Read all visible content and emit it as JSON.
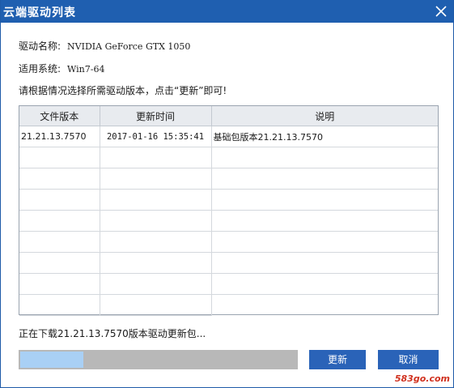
{
  "window": {
    "title": "云端驱动列表",
    "close_icon": "close-icon"
  },
  "info": {
    "driver_name_label": "驱动名称:",
    "driver_name_value": "NVIDIA GeForce GTX 1050",
    "system_label": "适用系统:",
    "system_value": "Win7-64",
    "instruction": "请根据情况选择所需驱动版本，点击“更新”即可!"
  },
  "table": {
    "headers": [
      "文件版本",
      "更新时间",
      "说明"
    ],
    "rows": [
      [
        "21.21.13.7570",
        "2017-01-16 15:35:41",
        "基础包版本21.21.13.7570"
      ]
    ]
  },
  "status": {
    "text": "正在下载21.21.13.7570版本驱动更新包...",
    "progress": 0.23
  },
  "buttons": {
    "update": "更新",
    "cancel": "取消"
  },
  "watermark": {
    "brand": "583go.com"
  },
  "colors": {
    "title_bar": "#1f5fb0",
    "button": "#2a63b8",
    "progress_fill": "#a9d0f5",
    "progress_track": "#b8b8b8"
  }
}
